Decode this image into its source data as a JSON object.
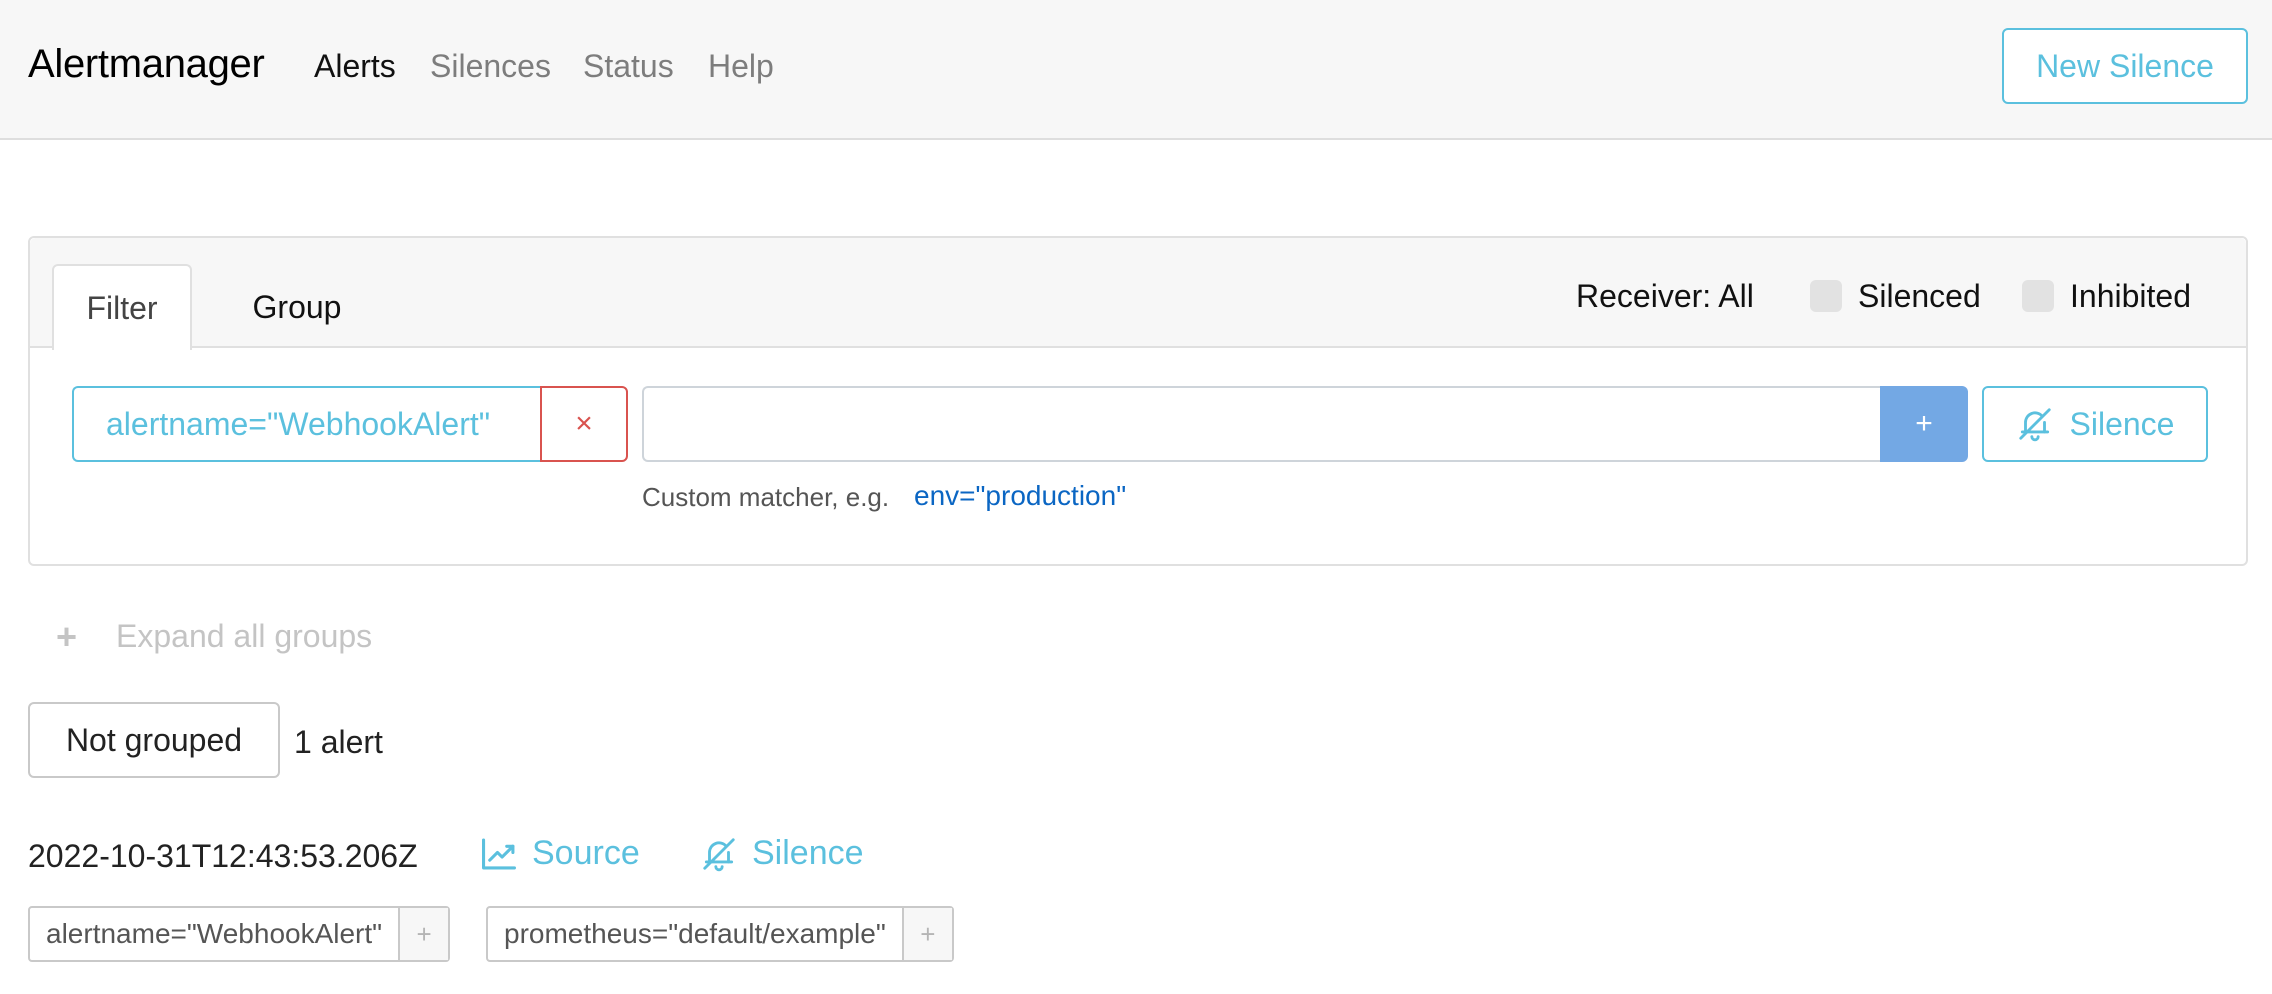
{
  "navbar": {
    "brand": "Alertmanager",
    "links": [
      "Alerts",
      "Silences",
      "Status",
      "Help"
    ],
    "active_link": "Alerts",
    "new_silence_label": "New Silence"
  },
  "filter_card": {
    "tabs": [
      "Filter",
      "Group"
    ],
    "active_tab": "Filter",
    "receiver_label": "Receiver: All",
    "silenced_label": "Silenced",
    "silenced_checked": false,
    "inhibited_label": "Inhibited",
    "inhibited_checked": false,
    "active_matcher": "alertname=\"WebhookAlert\"",
    "remove_matcher_label": "×",
    "custom_matcher_value": "",
    "add_label": "+",
    "silence_label": "Silence",
    "hint_text": "Custom matcher, e.g.",
    "hint_example": "env=\"production\""
  },
  "list": {
    "expand_all_label": "Expand all groups",
    "group_label": "Not grouped",
    "count_label": "1 alert"
  },
  "alert": {
    "timestamp": "2022-10-31T12:43:53.206Z",
    "source_label": "Source",
    "silence_label": "Silence",
    "labels": [
      {
        "text": "alertname=\"WebhookAlert\"",
        "add": "+"
      },
      {
        "text": "prometheus=\"default/example\"",
        "add": "+"
      }
    ]
  },
  "colors": {
    "info": "#5bc0de",
    "danger": "#d9534f",
    "primary_btn": "#73a8e4",
    "link": "#0b66c3",
    "navbar_bg": "#f7f7f7"
  },
  "icons": [
    "bell-slash-icon",
    "chart-line-icon",
    "plus-icon",
    "close-icon"
  ]
}
